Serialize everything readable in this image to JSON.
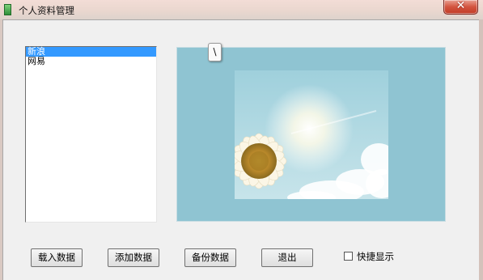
{
  "window": {
    "title": "个人资料管理",
    "close_label": "✕"
  },
  "list": {
    "items": [
      {
        "label": "新浪",
        "selected": true
      },
      {
        "label": "网易",
        "selected": false
      }
    ]
  },
  "picture": {
    "tab_label": "\\",
    "description_colors": {
      "panel": "#8fc4d2",
      "sky": "#a9d6e0"
    }
  },
  "buttons": {
    "load": "载入数据",
    "add": "添加数据",
    "backup": "备份数据",
    "exit": "退出"
  },
  "options": {
    "quick_display_label": "快捷显示",
    "quick_display_checked": false
  },
  "colors": {
    "selection": "#3399ff",
    "close_button": "#c13a26"
  }
}
